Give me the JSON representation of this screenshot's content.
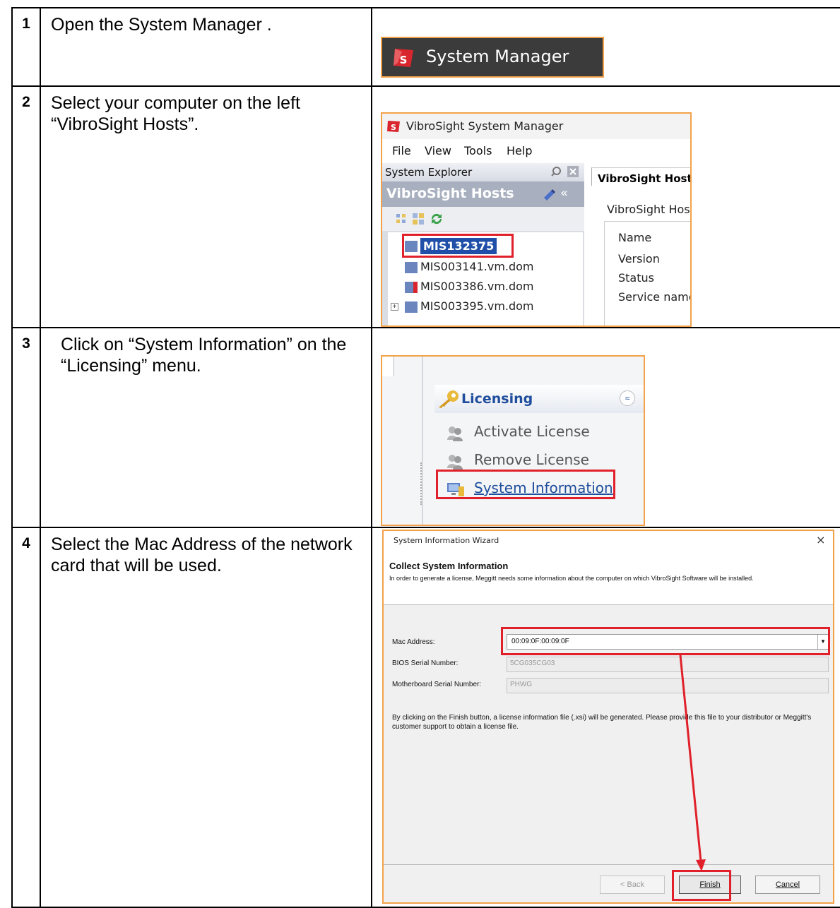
{
  "steps": [
    {
      "number": "1",
      "text": "Open the System Manager ."
    },
    {
      "number": "2",
      "text": "Select your computer on the left “VibroSight Hosts”."
    },
    {
      "number": "3",
      "text": "Click on “System Information” on the “Licensing” menu."
    },
    {
      "number": "4",
      "text": "Select the Mac Address of the network card that will be used."
    }
  ],
  "step1": {
    "app_button_label": "System Manager",
    "logo_letter": "S"
  },
  "step2": {
    "window_title": "VibroSight System Manager",
    "menu": [
      "File",
      "View",
      "Tools",
      "Help"
    ],
    "explorer_title": "System Explorer",
    "hosts_header": "VibroSight Hosts",
    "hosts": [
      "MIS132375",
      "MIS003141.vm.dom",
      "MIS003386.vm.dom",
      "MIS003395.vm.dom"
    ],
    "tab_label": "VibroSight Host :",
    "group_label": "VibroSight Hos",
    "fields": [
      "Name",
      "Version",
      "Status",
      "Service name"
    ]
  },
  "step3": {
    "panel_title": "Licensing",
    "items": [
      "Activate License",
      "Remove License",
      "System Information"
    ]
  },
  "step4": {
    "dialog_title": "System Information Wizard",
    "close_glyph": "×",
    "heading": "Collect System Information",
    "subheading": "In order to generate a license, Meggitt needs some information about the computer on which VibroSight Software will be installed.",
    "mac_label": "Mac Address:",
    "mac_value": "00:09:0F:00:09:0F",
    "bios_label": "BIOS Serial Number:",
    "bios_value": "5CG035CG03",
    "mb_label": "Motherboard Serial Number:",
    "mb_value": "PHWG",
    "note": "By clicking on the Finish button, a license information file (.xsi) will be generated. Please provide this file to your distributor or Meggitt's customer support to obtain a license file.",
    "back_label": "< Back",
    "finish_label": "Finish",
    "cancel_label": "Cancel"
  },
  "colors": {
    "highlight": "#e0202a",
    "border_orange": "#f3a24a",
    "link_blue": "#1f4e9c",
    "logo_red": "#d9262e"
  }
}
